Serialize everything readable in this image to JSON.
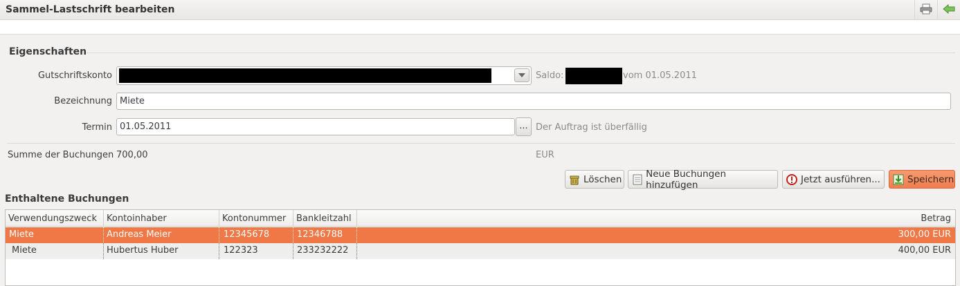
{
  "window": {
    "title": "Sammel-Lastschrift bearbeiten"
  },
  "toolbar": {
    "print_icon": "printer-icon",
    "back_icon": "back-arrow-icon"
  },
  "eigenschaften": {
    "heading": "Eigenschaften",
    "gutschriftskonto_label": "Gutschriftskonto",
    "saldo_label": "Saldo:",
    "saldo_suffix": "vom 01.05.2011",
    "bezeichnung_label": "Bezeichnung",
    "bezeichnung_value": "Miete",
    "termin_label": "Termin",
    "termin_value": "01.05.2011",
    "termin_button": "...",
    "termin_status": "Der Auftrag ist überfällig",
    "summe_label": "Summe der Buchungen",
    "summe_value": "700,00",
    "currency": "EUR"
  },
  "actions": {
    "delete": "Löschen",
    "add": "Neue Buchungen hinzufügen",
    "execute": "Jetzt ausführen...",
    "save": "Speichern"
  },
  "buchungen": {
    "heading": "Enthaltene Buchungen",
    "columns": [
      "Verwendungszweck",
      "Kontoinhaber",
      "Kontonummer",
      "Bankleitzahl",
      "Betrag"
    ],
    "rows": [
      {
        "zweck": "Miete",
        "inhaber": "Andreas Meier",
        "konto": "12345678",
        "blz": "12346788",
        "betrag": "300,00 EUR",
        "selected": true
      },
      {
        "zweck": "Miete",
        "inhaber": "Hubertus Huber",
        "konto": "122323",
        "blz": "233232222",
        "betrag": "400,00 EUR",
        "selected": false
      }
    ]
  },
  "colors": {
    "selection": "#f07746",
    "primary_button": "#ef7d4e"
  }
}
